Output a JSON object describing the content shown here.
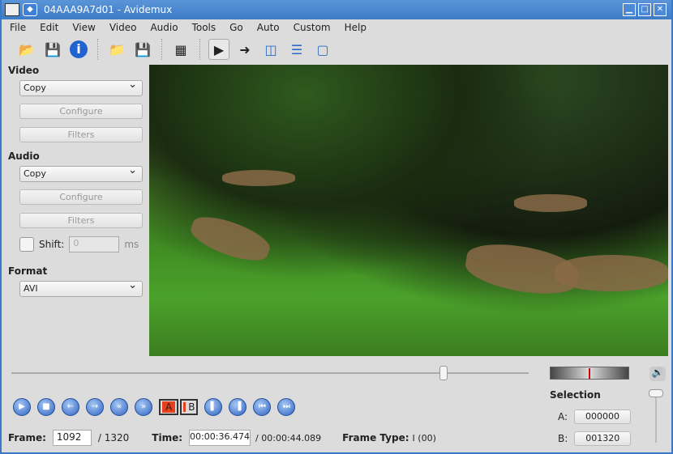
{
  "window": {
    "title": "04AAA9A7d01 - Avidemux"
  },
  "menu": [
    "File",
    "Edit",
    "View",
    "Video",
    "Audio",
    "Tools",
    "Go",
    "Auto",
    "Custom",
    "Help"
  ],
  "toolbar": [
    "open-icon",
    "save-icon",
    "info-icon",
    "open-folder-icon",
    "save-as-icon",
    "calculator-icon",
    "layout-input-icon",
    "layout-output-icon",
    "layout-split-vertical-icon",
    "layout-split-horizontal-icon",
    "layout-single-icon"
  ],
  "left": {
    "video_label": "Video",
    "video_codec": "Copy",
    "video_configure": "Configure",
    "video_filters": "Filters",
    "audio_label": "Audio",
    "audio_codec": "Copy",
    "audio_configure": "Configure",
    "audio_filters": "Filters",
    "shift_label": "Shift:",
    "shift_value": "0",
    "shift_unit": "ms",
    "format_label": "Format",
    "format_value": "AVI"
  },
  "timeline": {
    "position_fraction": 0.836
  },
  "playback": {
    "marker_a": "A",
    "marker_b": "B"
  },
  "status": {
    "frame_label": "Frame:",
    "frame_value": "1092",
    "frame_total": "/ 1320",
    "time_label": "Time:",
    "time_value": "00:00:36.474",
    "time_total": "/ 00:00:44.089",
    "frame_type_label": "Frame Type:",
    "frame_type_value": "I (00)"
  },
  "selection": {
    "title": "Selection",
    "a_label": "A:",
    "a_value": "000000",
    "b_label": "B:",
    "b_value": "001320"
  },
  "colors": {
    "accent": "#3d7bc7",
    "marker": "#e8401c"
  }
}
